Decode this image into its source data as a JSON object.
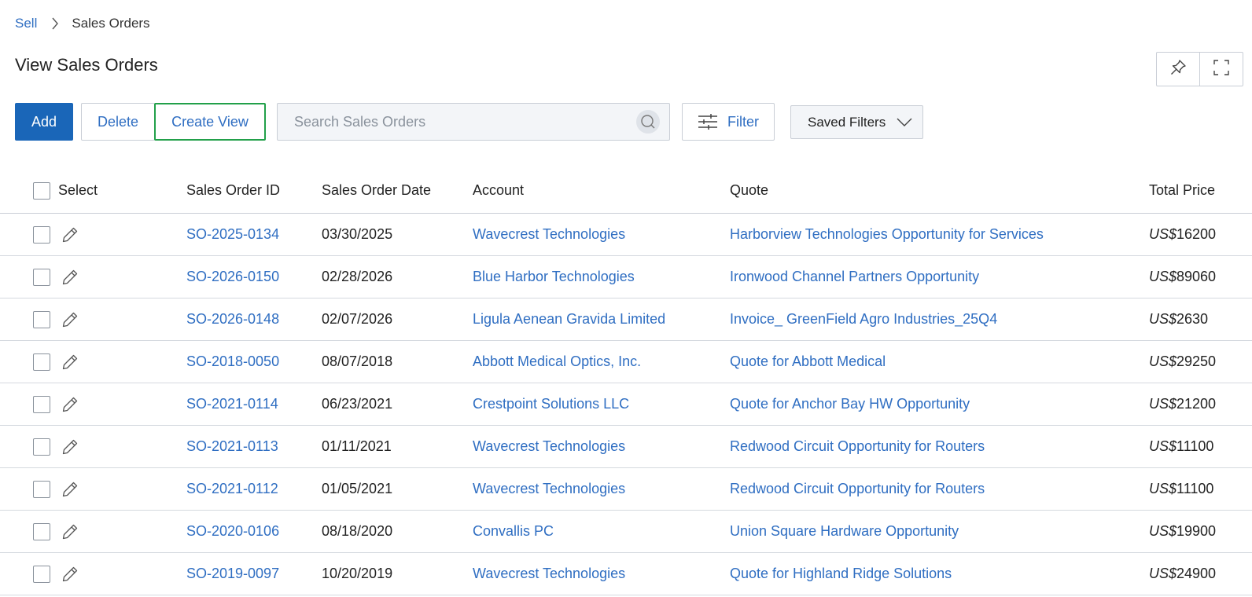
{
  "breadcrumb": {
    "parent": "Sell",
    "current": "Sales Orders"
  },
  "page": {
    "title": "View Sales Orders"
  },
  "toolbar": {
    "add_label": "Add",
    "delete_label": "Delete",
    "create_view_label": "Create View",
    "search_placeholder": "Search Sales Orders",
    "filter_label": "Filter",
    "saved_filters_label": "Saved Filters"
  },
  "icons": {
    "breadcrumb_separator": "chevron-right-icon",
    "pin": "pin-icon",
    "fullscreen": "fullscreen-icon",
    "search": "search-icon",
    "filter": "sliders-icon",
    "saved_filters": "chevron-down-icon",
    "row_edit": "pencil-icon"
  },
  "colors": {
    "primary": "#1a66b8",
    "link": "#2f6ec2",
    "focus_outline": "#22a04a",
    "border": "#c9ced6"
  },
  "table": {
    "columns": {
      "select": "Select",
      "id": "Sales Order ID",
      "date": "Sales Order Date",
      "account": "Account",
      "quote": "Quote",
      "price": "Total Price"
    },
    "rows": [
      {
        "id": "SO-2025-0134",
        "date": "03/30/2025",
        "account": "Wavecrest Technologies",
        "quote": "Harborview Technologies Opportunity for Services",
        "currency": "US$",
        "price": "16200"
      },
      {
        "id": "SO-2026-0150",
        "date": "02/28/2026",
        "account": "Blue Harbor Technologies",
        "quote": "Ironwood Channel Partners Opportunity",
        "currency": "US$",
        "price": "89060"
      },
      {
        "id": "SO-2026-0148",
        "date": "02/07/2026",
        "account": "Ligula Aenean Gravida Limited",
        "quote": "Invoice_ GreenField Agro Industries_25Q4",
        "currency": "US$",
        "price": "2630"
      },
      {
        "id": "SO-2018-0050",
        "date": "08/07/2018",
        "account": "Abbott Medical Optics, Inc.",
        "quote": "Quote for Abbott Medical",
        "currency": "US$",
        "price": "29250"
      },
      {
        "id": "SO-2021-0114",
        "date": "06/23/2021",
        "account": "Crestpoint Solutions LLC",
        "quote": "Quote for Anchor Bay HW Opportunity",
        "currency": "US$",
        "price": "21200"
      },
      {
        "id": "SO-2021-0113",
        "date": "01/11/2021",
        "account": "Wavecrest Technologies",
        "quote": "Redwood Circuit Opportunity for Routers",
        "currency": "US$",
        "price": "11100"
      },
      {
        "id": "SO-2021-0112",
        "date": "01/05/2021",
        "account": "Wavecrest Technologies",
        "quote": "Redwood Circuit Opportunity for Routers",
        "currency": "US$",
        "price": "11100"
      },
      {
        "id": "SO-2020-0106",
        "date": "08/18/2020",
        "account": "Convallis PC",
        "quote": "Union Square Hardware Opportunity",
        "currency": "US$",
        "price": "19900"
      },
      {
        "id": "SO-2019-0097",
        "date": "10/20/2019",
        "account": "Wavecrest Technologies",
        "quote": "Quote for Highland Ridge Solutions",
        "currency": "US$",
        "price": "24900"
      }
    ]
  }
}
